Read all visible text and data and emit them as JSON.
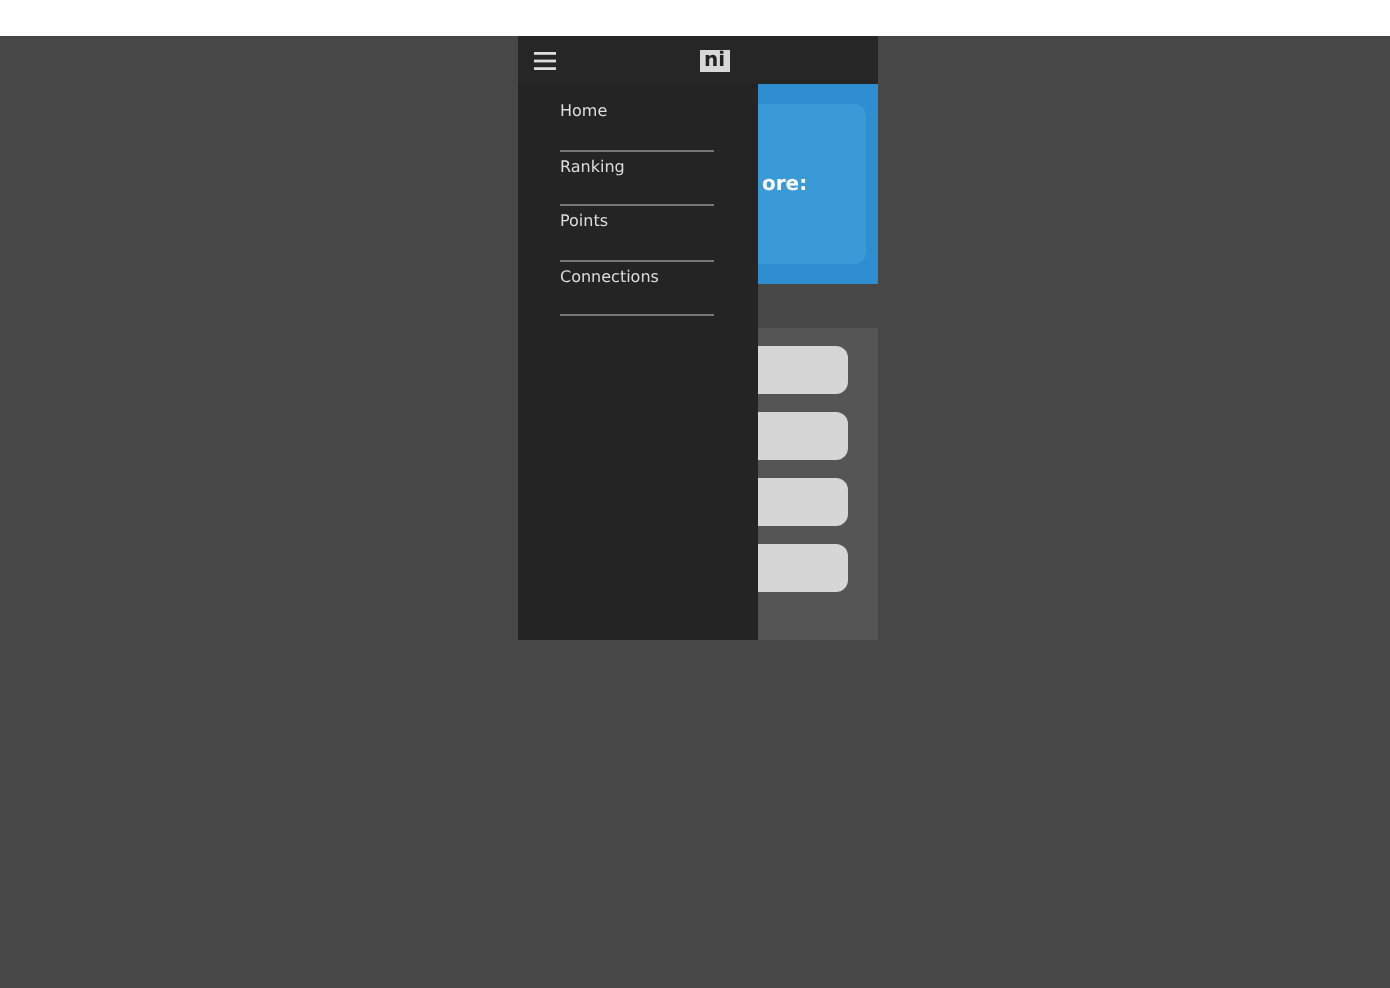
{
  "header": {
    "logo": "ni"
  },
  "menu": [
    {
      "label": "Home"
    },
    {
      "label": "Ranking"
    },
    {
      "label": "Points"
    },
    {
      "label": "Connections"
    }
  ],
  "score_card": {
    "label": "ore:"
  },
  "buttons": [
    {
      "kind": "blank"
    },
    {
      "kind": "blank"
    },
    {
      "kind": "blank"
    },
    {
      "kind": "blank"
    }
  ]
}
